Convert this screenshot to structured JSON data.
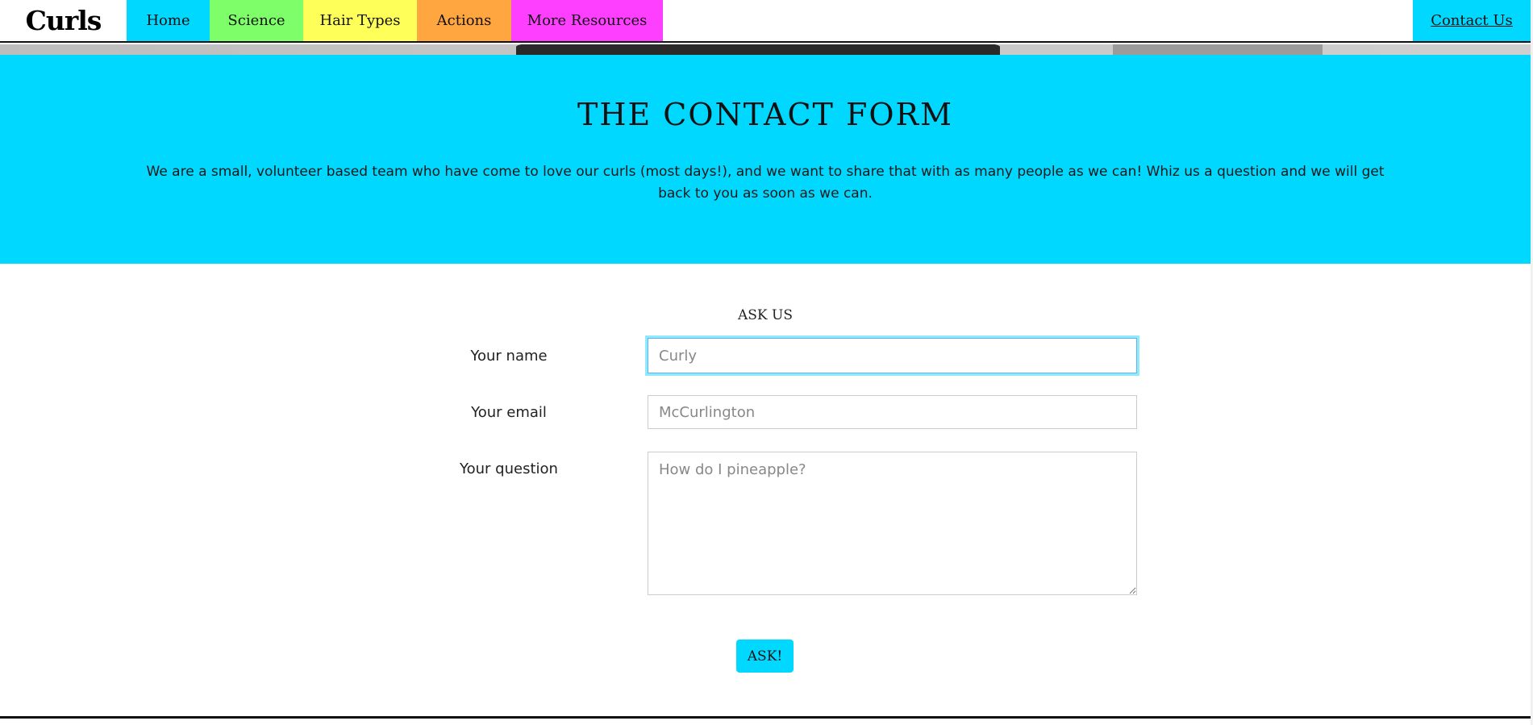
{
  "nav": {
    "brand": "Curls",
    "items": [
      {
        "label": "Home",
        "color": "#00D8FF"
      },
      {
        "label": "Science",
        "color": "#7EFF6A"
      },
      {
        "label": "Hair Types",
        "color": "#FFFF5A"
      },
      {
        "label": "Actions",
        "color": "#FFA640"
      },
      {
        "label": "More Resources",
        "color": "#FF3FFF"
      }
    ],
    "contact": "Contact Us"
  },
  "banner": {
    "title": "THE CONTACT FORM",
    "text": "We are a small, volunteer based team who have come to love our curls (most days!), and we want to share that with as many people as we can! Whiz us a question and we will get back to you as soon as we can.",
    "color": "#00D8FF"
  },
  "form": {
    "title": "ASK US",
    "name_label": "Your name",
    "name_placeholder": "Curly",
    "email_label": "Your email",
    "email_placeholder": "McCurlington",
    "question_label": "Your question",
    "question_placeholder": "How do I pineapple?",
    "submit_label": "ASK!"
  }
}
